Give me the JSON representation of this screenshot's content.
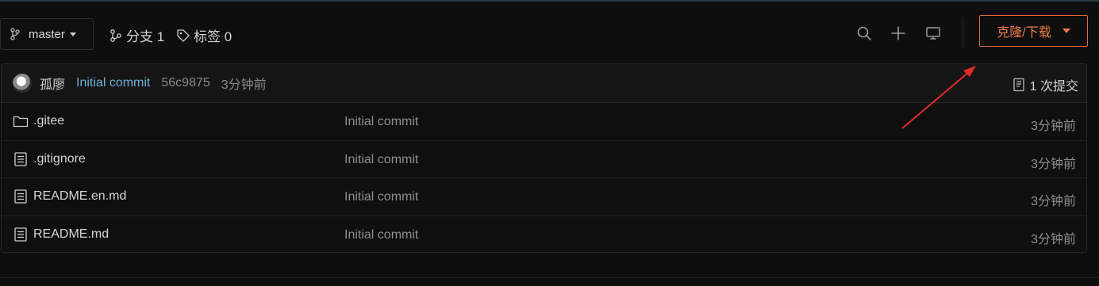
{
  "toolbar": {
    "branch_name": "master",
    "branches_label": "分支 1",
    "tags_label": "标签 0",
    "clone_label": "克隆/下载"
  },
  "icons": {
    "branch": "git-branch-icon",
    "branches": "branch-icon",
    "tag": "tag-icon",
    "search": "search-icon",
    "add": "plus-icon",
    "monitor": "monitor-icon",
    "folder": "folder-icon",
    "file": "file-icon",
    "commits": "commit-book-icon"
  },
  "commit": {
    "author": "孤廖",
    "message": "Initial commit",
    "sha": "56c9875",
    "time": "3分钟前",
    "count_label": "1 次提交"
  },
  "files": [
    {
      "name": ".gitee",
      "type": "folder",
      "message": "Initial commit",
      "time": "3分钟前"
    },
    {
      "name": ".gitignore",
      "type": "file",
      "message": "Initial commit",
      "time": "3分钟前"
    },
    {
      "name": "README.en.md",
      "type": "file",
      "message": "Initial commit",
      "time": "3分钟前"
    },
    {
      "name": "README.md",
      "type": "file",
      "message": "Initial commit",
      "time": "3分钟前"
    }
  ],
  "colors": {
    "background": "#0e0e0e",
    "accent": "#ee7a45",
    "link": "#6fb1d8",
    "annotation_arrow": "#e02b2b"
  }
}
